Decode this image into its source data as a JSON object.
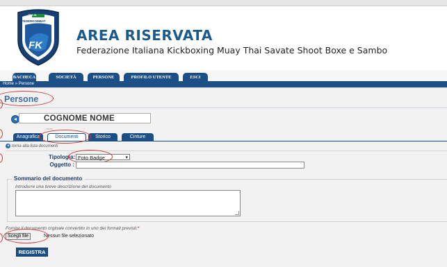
{
  "header": {
    "logo_text": "FEDERKOMBAT",
    "logo_country": "ITALIA",
    "logo_monogram": "FK",
    "title": "AREA RISERVATA",
    "subtitle": "Federazione Italiana Kickboxing Muay Thai Savate Shoot Boxe e Sambo"
  },
  "nav": {
    "items": [
      {
        "label": "BACHECA"
      },
      {
        "label": "SOCIETÀ"
      },
      {
        "label": "PERSONE"
      },
      {
        "label": "PROFILO UTENTE"
      },
      {
        "label": "ESCI"
      }
    ]
  },
  "breadcrumb": {
    "home": "Home",
    "separator": "»",
    "current": "Persone"
  },
  "page": {
    "title": "Persone",
    "person_name": "COGNOME NOME",
    "stars": "*****"
  },
  "tabs": [
    {
      "label": "Anagrafica",
      "active": false
    },
    {
      "label": "Documenti",
      "active": true
    },
    {
      "label": "Storico",
      "active": false
    },
    {
      "label": "Cinture",
      "active": false
    }
  ],
  "back_link": {
    "label": "torna alla lista documenti"
  },
  "form": {
    "tipologia_label": "Tipologia:",
    "tipologia_value": "Foto Badge",
    "oggetto_label": "Oggetto :",
    "oggetto_value": "",
    "summary_legend": "Sommario del documento",
    "summary_hint": "Introdurre una breve descrizione del documento",
    "summary_value": "",
    "file_note": "Fornire il documento orginale convertito in uno dei formati previsti:",
    "file_required_mark": "*",
    "file_button": "Scegli file",
    "file_status": "Nessun file selezionato",
    "submit_label": "REGISTRA"
  },
  "colors": {
    "accent": "#1c4f86",
    "title": "#1d5a8c",
    "annotation": "#d23a3a"
  }
}
